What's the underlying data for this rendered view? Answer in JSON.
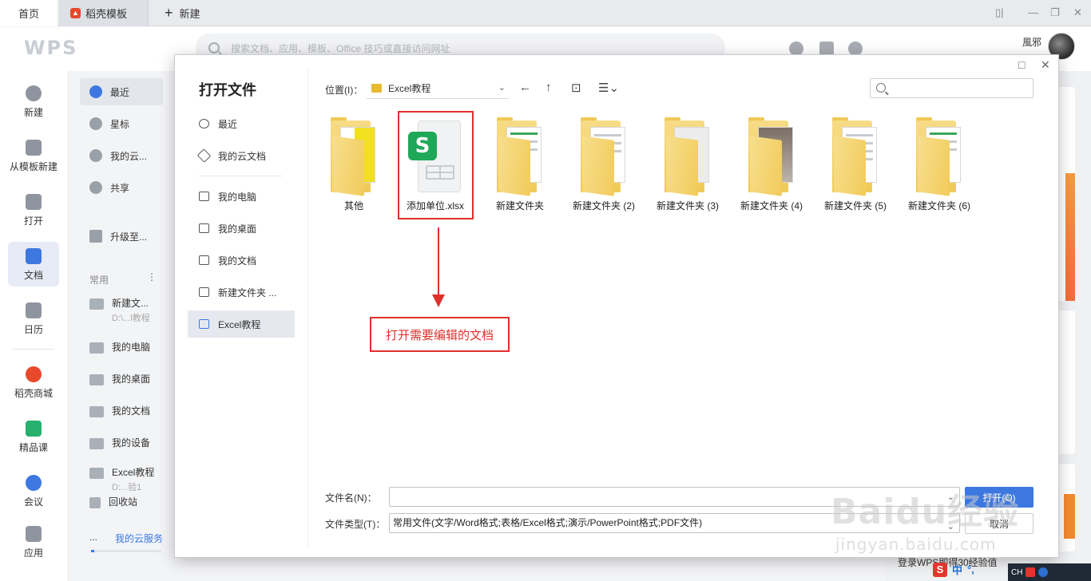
{
  "tabs": {
    "home": "首页",
    "daoke": "稻壳模板",
    "new": "新建"
  },
  "header": {
    "logo": "WPS",
    "search_placeholder": "搜索文档、应用、模板、Office 技巧或直接访问网址",
    "user_name": "風邪"
  },
  "rail": [
    {
      "label": "新建",
      "icon": "plus-icon"
    },
    {
      "label": "从模板新建",
      "icon": "template-icon"
    },
    {
      "label": "打开",
      "icon": "folder-icon"
    },
    {
      "label": "文档",
      "icon": "document-icon",
      "active": true
    },
    {
      "label": "日历",
      "icon": "calendar-icon"
    },
    {
      "label": "稻壳商城",
      "icon": "daoke-icon"
    },
    {
      "label": "精品课",
      "icon": "course-icon"
    },
    {
      "label": "会议",
      "icon": "meeting-icon"
    },
    {
      "label": "应用",
      "icon": "apps-icon"
    }
  ],
  "panel2": {
    "recent": "最近",
    "star": "星标",
    "cloud": "我的云...",
    "share": "共享",
    "upgrade": "升级至...",
    "common_label": "常用",
    "new_folder": "新建文...",
    "new_folder_path": "D:\\...l教程",
    "my_pc": "我的电脑",
    "my_desktop": "我的桌面",
    "my_docs": "我的文档",
    "my_devices": "我的设备",
    "excel": "Excel教程",
    "excel_path": "D:...验1",
    "trash": "回收站",
    "cloud_service_dots": "...",
    "cloud_service": "我的云服务"
  },
  "right": {
    "login_text": "登录WPS即得30经验值"
  },
  "dialog": {
    "title": "打开文件",
    "nav": {
      "recent": "最近",
      "cloud": "我的云文档",
      "pc": "我的电脑",
      "desktop": "我的桌面",
      "docs": "我的文档",
      "new_folder": "新建文件夹 ...",
      "excel": "Excel教程"
    },
    "location_label": "位置(I)：",
    "location_value": "Excel教程",
    "files": [
      {
        "name": "其他",
        "type": "folder"
      },
      {
        "name": "添加单位.xlsx",
        "type": "xlsx"
      },
      {
        "name": "新建文件夹",
        "type": "folder"
      },
      {
        "name": "新建文件夹 (2)",
        "type": "folder"
      },
      {
        "name": "新建文件夹 (3)",
        "type": "folder"
      },
      {
        "name": "新建文件夹 (4)",
        "type": "folder"
      },
      {
        "name": "新建文件夹 (5)",
        "type": "folder"
      },
      {
        "name": "新建文件夹 (6)",
        "type": "folder"
      }
    ],
    "callout": "打开需要编辑的文档",
    "filename_label": "文件名(N)：",
    "filename_value": "",
    "filetype_label": "文件类型(T)：",
    "filetype_value": "常用文件(文字/Word格式;表格/Excel格式;演示/PowerPoint格式;PDF文件)",
    "open_button": "打开(O)",
    "cancel_button": "取消"
  },
  "watermark": {
    "main": "Baidu经验",
    "sub": "jingyan.baidu.com"
  },
  "tray": {
    "ime_cn": "中",
    "ime_punct": "°,",
    "lang": "CH"
  },
  "colors": {
    "accent": "#3c78e0",
    "annotation": "#e0302c",
    "excel_green": "#1fa858"
  }
}
